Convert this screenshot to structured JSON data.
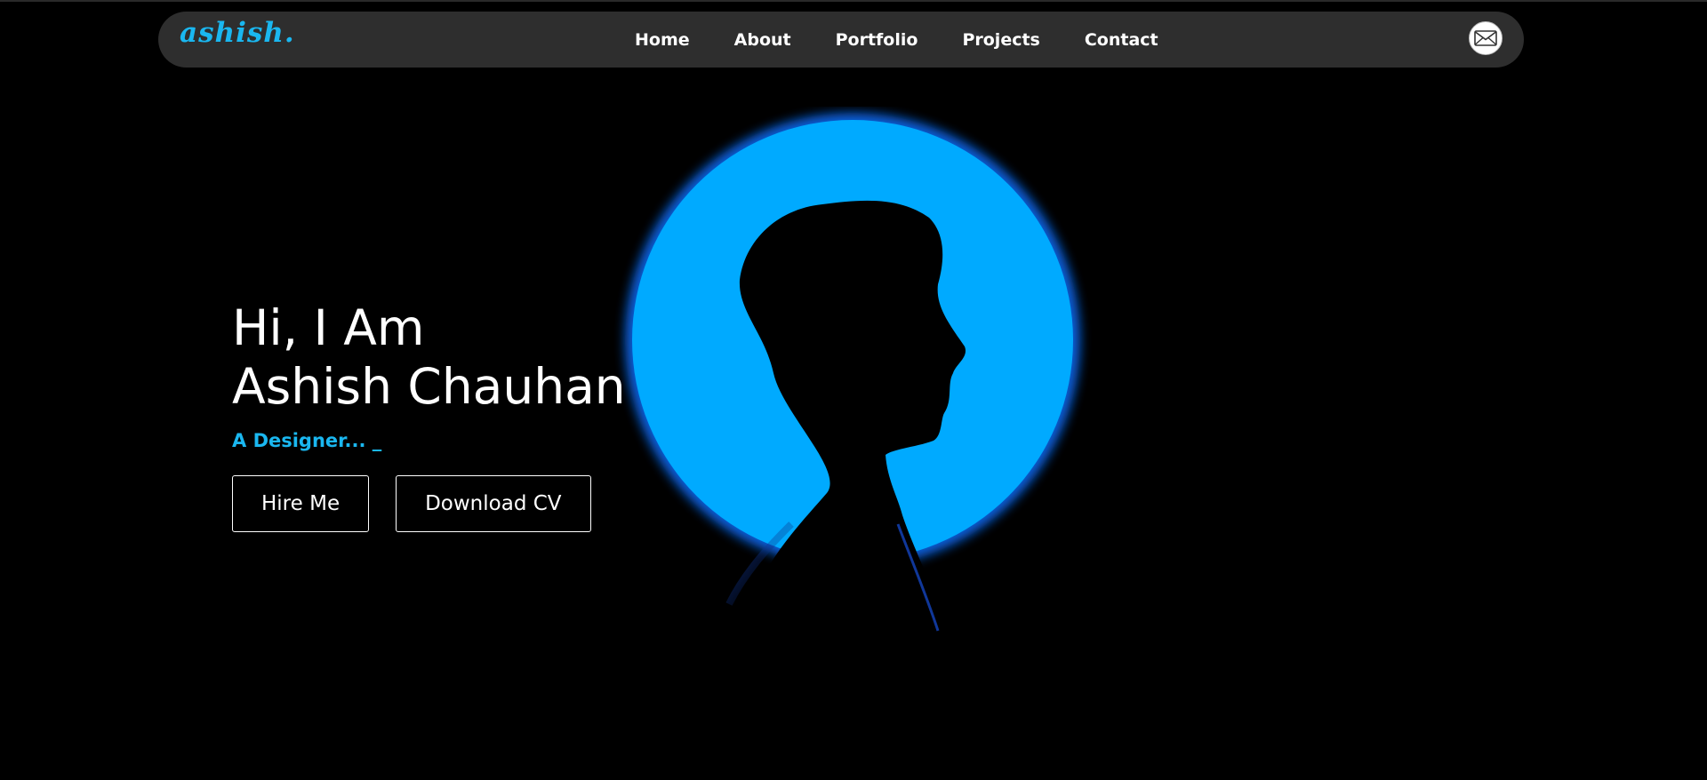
{
  "brand": {
    "logo_text": "ashish."
  },
  "nav": {
    "items": [
      {
        "label": "Home"
      },
      {
        "label": "About"
      },
      {
        "label": "Portfolio"
      },
      {
        "label": "Projects"
      },
      {
        "label": "Contact"
      }
    ],
    "mail_icon": "mail-icon"
  },
  "hero": {
    "greeting_line1": "Hi, I Am",
    "greeting_line2": "Ashish Chauhan",
    "subtitle": "A Designer... _",
    "buttons": {
      "hire_label": "Hire Me",
      "cv_label": "Download CV"
    },
    "image": "silhouette-portrait"
  },
  "colors": {
    "background": "#000000",
    "navbar": "#2e2e2e",
    "accent": "#1ab7f0",
    "circle": "#00aaff",
    "text": "#ffffff"
  }
}
